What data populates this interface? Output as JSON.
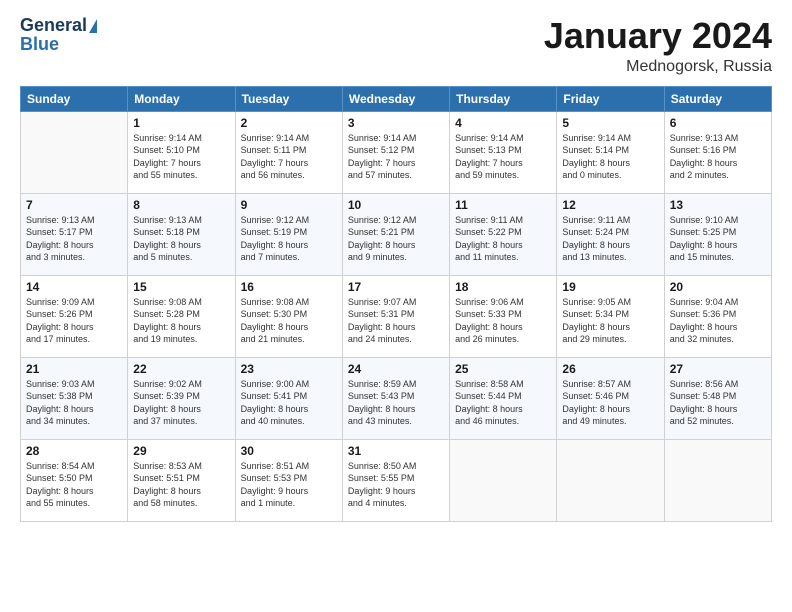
{
  "header": {
    "logo_general": "General",
    "logo_blue": "Blue",
    "title": "January 2024",
    "location": "Mednogorsk, Russia"
  },
  "days_of_week": [
    "Sunday",
    "Monday",
    "Tuesday",
    "Wednesday",
    "Thursday",
    "Friday",
    "Saturday"
  ],
  "weeks": [
    [
      {
        "day": "",
        "info": ""
      },
      {
        "day": "1",
        "info": "Sunrise: 9:14 AM\nSunset: 5:10 PM\nDaylight: 7 hours\nand 55 minutes."
      },
      {
        "day": "2",
        "info": "Sunrise: 9:14 AM\nSunset: 5:11 PM\nDaylight: 7 hours\nand 56 minutes."
      },
      {
        "day": "3",
        "info": "Sunrise: 9:14 AM\nSunset: 5:12 PM\nDaylight: 7 hours\nand 57 minutes."
      },
      {
        "day": "4",
        "info": "Sunrise: 9:14 AM\nSunset: 5:13 PM\nDaylight: 7 hours\nand 59 minutes."
      },
      {
        "day": "5",
        "info": "Sunrise: 9:14 AM\nSunset: 5:14 PM\nDaylight: 8 hours\nand 0 minutes."
      },
      {
        "day": "6",
        "info": "Sunrise: 9:13 AM\nSunset: 5:16 PM\nDaylight: 8 hours\nand 2 minutes."
      }
    ],
    [
      {
        "day": "7",
        "info": "Sunrise: 9:13 AM\nSunset: 5:17 PM\nDaylight: 8 hours\nand 3 minutes."
      },
      {
        "day": "8",
        "info": "Sunrise: 9:13 AM\nSunset: 5:18 PM\nDaylight: 8 hours\nand 5 minutes."
      },
      {
        "day": "9",
        "info": "Sunrise: 9:12 AM\nSunset: 5:19 PM\nDaylight: 8 hours\nand 7 minutes."
      },
      {
        "day": "10",
        "info": "Sunrise: 9:12 AM\nSunset: 5:21 PM\nDaylight: 8 hours\nand 9 minutes."
      },
      {
        "day": "11",
        "info": "Sunrise: 9:11 AM\nSunset: 5:22 PM\nDaylight: 8 hours\nand 11 minutes."
      },
      {
        "day": "12",
        "info": "Sunrise: 9:11 AM\nSunset: 5:24 PM\nDaylight: 8 hours\nand 13 minutes."
      },
      {
        "day": "13",
        "info": "Sunrise: 9:10 AM\nSunset: 5:25 PM\nDaylight: 8 hours\nand 15 minutes."
      }
    ],
    [
      {
        "day": "14",
        "info": "Sunrise: 9:09 AM\nSunset: 5:26 PM\nDaylight: 8 hours\nand 17 minutes."
      },
      {
        "day": "15",
        "info": "Sunrise: 9:08 AM\nSunset: 5:28 PM\nDaylight: 8 hours\nand 19 minutes."
      },
      {
        "day": "16",
        "info": "Sunrise: 9:08 AM\nSunset: 5:30 PM\nDaylight: 8 hours\nand 21 minutes."
      },
      {
        "day": "17",
        "info": "Sunrise: 9:07 AM\nSunset: 5:31 PM\nDaylight: 8 hours\nand 24 minutes."
      },
      {
        "day": "18",
        "info": "Sunrise: 9:06 AM\nSunset: 5:33 PM\nDaylight: 8 hours\nand 26 minutes."
      },
      {
        "day": "19",
        "info": "Sunrise: 9:05 AM\nSunset: 5:34 PM\nDaylight: 8 hours\nand 29 minutes."
      },
      {
        "day": "20",
        "info": "Sunrise: 9:04 AM\nSunset: 5:36 PM\nDaylight: 8 hours\nand 32 minutes."
      }
    ],
    [
      {
        "day": "21",
        "info": "Sunrise: 9:03 AM\nSunset: 5:38 PM\nDaylight: 8 hours\nand 34 minutes."
      },
      {
        "day": "22",
        "info": "Sunrise: 9:02 AM\nSunset: 5:39 PM\nDaylight: 8 hours\nand 37 minutes."
      },
      {
        "day": "23",
        "info": "Sunrise: 9:00 AM\nSunset: 5:41 PM\nDaylight: 8 hours\nand 40 minutes."
      },
      {
        "day": "24",
        "info": "Sunrise: 8:59 AM\nSunset: 5:43 PM\nDaylight: 8 hours\nand 43 minutes."
      },
      {
        "day": "25",
        "info": "Sunrise: 8:58 AM\nSunset: 5:44 PM\nDaylight: 8 hours\nand 46 minutes."
      },
      {
        "day": "26",
        "info": "Sunrise: 8:57 AM\nSunset: 5:46 PM\nDaylight: 8 hours\nand 49 minutes."
      },
      {
        "day": "27",
        "info": "Sunrise: 8:56 AM\nSunset: 5:48 PM\nDaylight: 8 hours\nand 52 minutes."
      }
    ],
    [
      {
        "day": "28",
        "info": "Sunrise: 8:54 AM\nSunset: 5:50 PM\nDaylight: 8 hours\nand 55 minutes."
      },
      {
        "day": "29",
        "info": "Sunrise: 8:53 AM\nSunset: 5:51 PM\nDaylight: 8 hours\nand 58 minutes."
      },
      {
        "day": "30",
        "info": "Sunrise: 8:51 AM\nSunset: 5:53 PM\nDaylight: 9 hours\nand 1 minute."
      },
      {
        "day": "31",
        "info": "Sunrise: 8:50 AM\nSunset: 5:55 PM\nDaylight: 9 hours\nand 4 minutes."
      },
      {
        "day": "",
        "info": ""
      },
      {
        "day": "",
        "info": ""
      },
      {
        "day": "",
        "info": ""
      }
    ]
  ]
}
